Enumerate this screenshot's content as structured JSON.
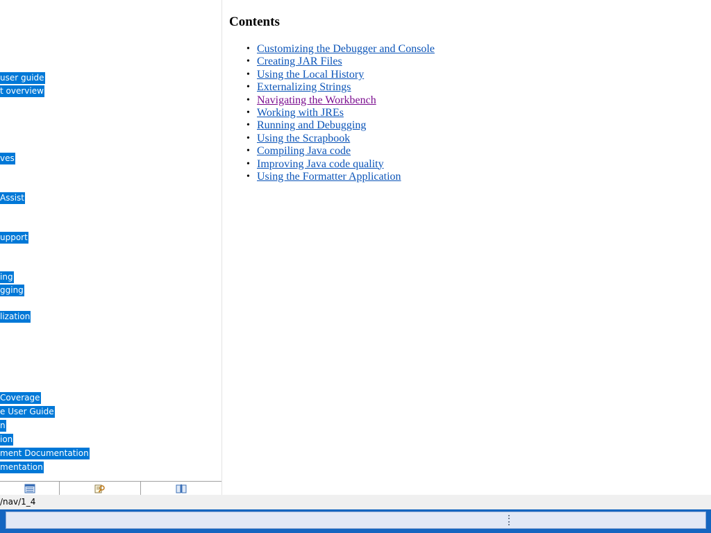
{
  "nav": {
    "toc_items": [
      "user guide",
      "t overview",
      "ves",
      " Assist",
      "upport",
      "ing",
      "gging",
      "lization",
      " Coverage",
      "e User Guide",
      "n",
      "ion",
      "ment Documentation",
      "mentation"
    ],
    "tabs": [
      {
        "icon": "contents-icon"
      },
      {
        "icon": "search-results-icon"
      },
      {
        "icon": "bookmarks-icon"
      }
    ]
  },
  "content": {
    "title": "Contents",
    "links": [
      {
        "label": "Customizing the Debugger and Console",
        "visited": false
      },
      {
        "label": "Creating JAR Files",
        "visited": false
      },
      {
        "label": "Using the Local History",
        "visited": false
      },
      {
        "label": "Externalizing Strings",
        "visited": false
      },
      {
        "label": "Navigating the Workbench",
        "visited": true
      },
      {
        "label": "Working with JREs",
        "visited": false
      },
      {
        "label": "Running and Debugging",
        "visited": false
      },
      {
        "label": "Using the Scrapbook",
        "visited": false
      },
      {
        "label": "Compiling Java code",
        "visited": false
      },
      {
        "label": "Improving Java code quality",
        "visited": false
      },
      {
        "label": "Using the Formatter Application",
        "visited": false
      }
    ]
  },
  "status": {
    "text": "/nav/1_4"
  },
  "colors": {
    "selection": "#0078d7",
    "link": "#0b54b8",
    "visited_link": "#7b0d8f",
    "taskbar": "#1565c0"
  }
}
